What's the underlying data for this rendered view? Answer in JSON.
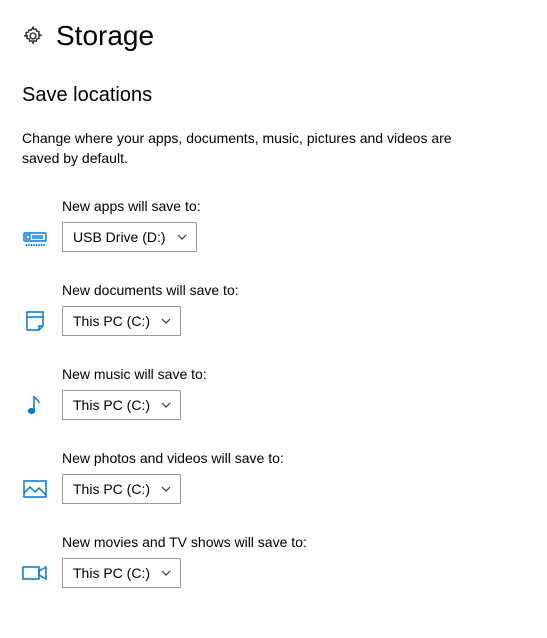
{
  "header": {
    "title": "Storage"
  },
  "section": {
    "title": "Save locations",
    "description": "Change where your apps, documents, music, pictures and videos are saved by default."
  },
  "settings": {
    "apps": {
      "label": "New apps will save to:",
      "value": "USB Drive (D:)"
    },
    "documents": {
      "label": "New documents will save to:",
      "value": "This PC (C:)"
    },
    "music": {
      "label": "New music will save to:",
      "value": "This PC (C:)"
    },
    "photos": {
      "label": "New photos and videos will save to:",
      "value": "This PC (C:)"
    },
    "movies": {
      "label": "New movies and TV shows will save to:",
      "value": "This PC (C:)"
    }
  },
  "colors": {
    "accent": "#0078d7"
  }
}
